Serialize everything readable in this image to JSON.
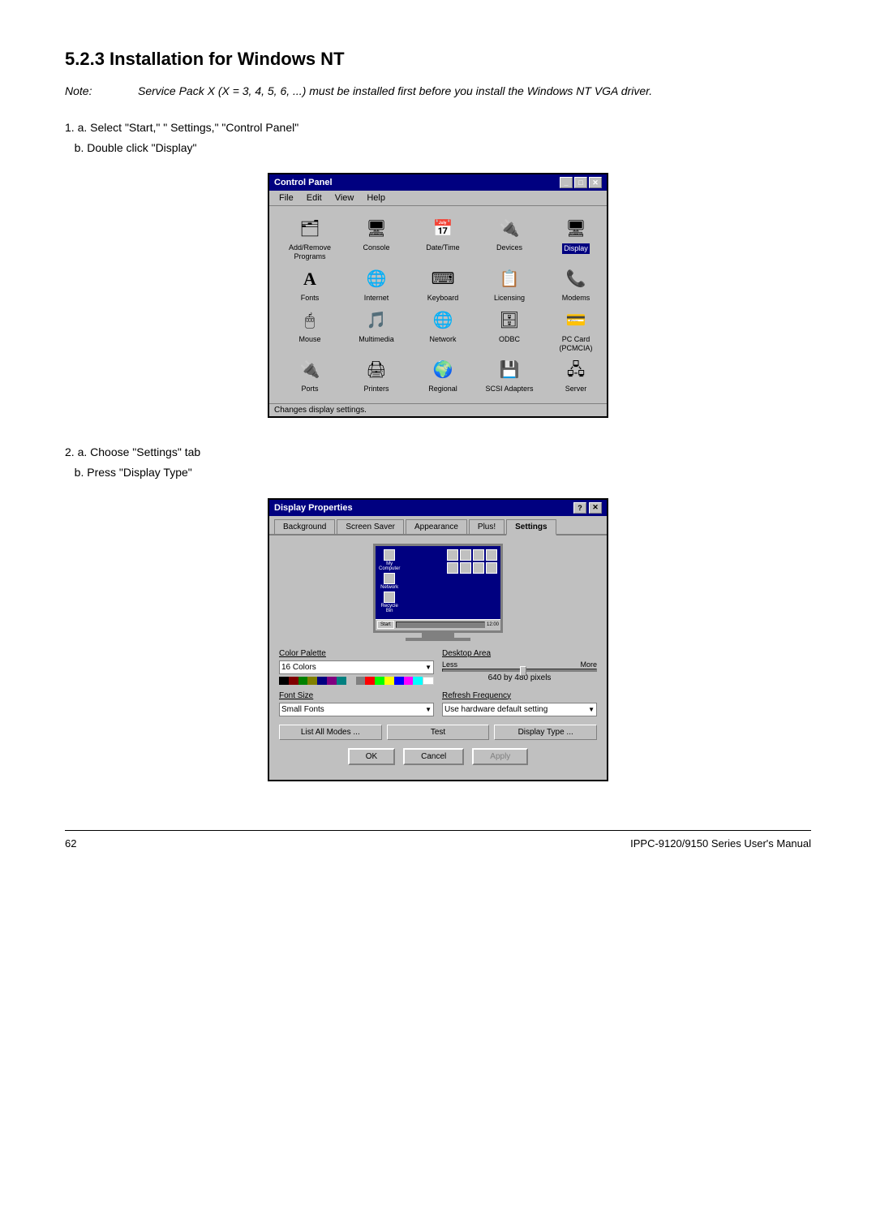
{
  "heading": "5.2.3 Installation for Windows NT",
  "note": {
    "label": "Note:",
    "text": "Service Pack X (X = 3, 4, 5, 6, ...) must be installed first before you install the Windows NT VGA driver."
  },
  "step1": {
    "label": "1.",
    "text_a": "a. Select \"Start,\" \" Settings,\" \"Control Panel\"",
    "text_b": "b. Double click \"Display\""
  },
  "step2": {
    "label": "2.",
    "text_a": "a. Choose \"Settings\" tab",
    "text_b": "b. Press \"Display Type\""
  },
  "control_panel": {
    "title": "Control Panel",
    "menu_items": [
      "File",
      "Edit",
      "View",
      "Help"
    ],
    "icons": [
      {
        "name": "Add/Remove\nPrograms",
        "icon": "🗂"
      },
      {
        "name": "Console",
        "icon": "🖥"
      },
      {
        "name": "Date/Time",
        "icon": "📅"
      },
      {
        "name": "Devices",
        "icon": "🔌"
      },
      {
        "name": "Display",
        "icon": "🖥",
        "selected": true
      },
      {
        "name": "Fonts",
        "icon": "A"
      },
      {
        "name": "Internet",
        "icon": "🌐"
      },
      {
        "name": "Keyboard",
        "icon": "⌨"
      },
      {
        "name": "Licensing",
        "icon": "📋"
      },
      {
        "name": "Modems",
        "icon": "📞"
      },
      {
        "name": "Mouse",
        "icon": "🖱"
      },
      {
        "name": "Multimedia",
        "icon": "🎵"
      },
      {
        "name": "Network",
        "icon": "🌐"
      },
      {
        "name": "ODBC",
        "icon": "🗄"
      },
      {
        "name": "PC Card\n(PCMCIA)",
        "icon": "💳"
      },
      {
        "name": "Ports",
        "icon": "🔌"
      },
      {
        "name": "Printers",
        "icon": "🖨"
      },
      {
        "name": "Regional",
        "icon": "🌍"
      },
      {
        "name": "SCSI Adapters",
        "icon": "💾"
      },
      {
        "name": "Server",
        "icon": "🖧"
      }
    ],
    "statusbar": "Changes display settings."
  },
  "display_properties": {
    "title": "Display Properties",
    "tabs": [
      "Background",
      "Screen Saver",
      "Appearance",
      "Plus!",
      "Settings"
    ],
    "active_tab": "Settings",
    "color_palette": {
      "label": "Color Palette",
      "value": "16 Colors",
      "colors": [
        "#000000",
        "#800000",
        "#008000",
        "#808000",
        "#000080",
        "#800080",
        "#008080",
        "#c0c0c0",
        "#808080",
        "#ff0000",
        "#00ff00",
        "#ffff00",
        "#0000ff",
        "#ff00ff",
        "#00ffff",
        "#ffffff"
      ]
    },
    "desktop_area": {
      "label": "Desktop Area",
      "less": "Less",
      "more": "More",
      "pixel_label": "640 by 480 pixels"
    },
    "font_size": {
      "label": "Font Size",
      "value": "Small Fonts"
    },
    "refresh_frequency": {
      "label": "Refresh Frequency",
      "value": "Use hardware default setting"
    },
    "buttons": {
      "list_all": "List All Modes ...",
      "test": "Test",
      "display_type": "Display Type ..."
    },
    "ok": "OK",
    "cancel": "Cancel",
    "apply": "Apply"
  },
  "footer": {
    "page_number": "62",
    "manual_title": "IPPC-9120/9150 Series User's Manual"
  }
}
